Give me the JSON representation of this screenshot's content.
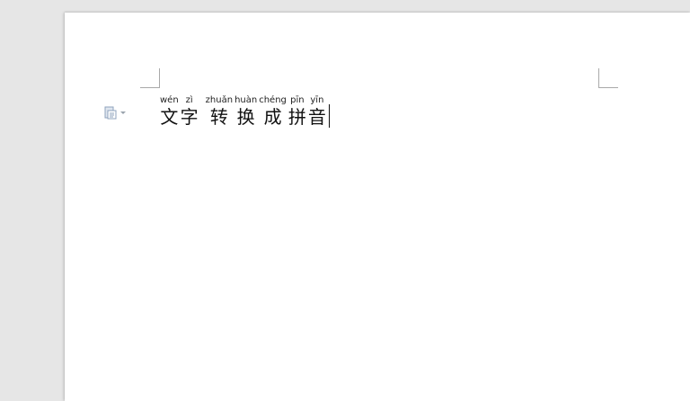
{
  "document": {
    "ruby_text": [
      {
        "hanzi": "文",
        "pinyin": "wén"
      },
      {
        "hanzi": "字",
        "pinyin": "zì"
      },
      {
        "hanzi": "转",
        "pinyin": "zhuǎn"
      },
      {
        "hanzi": "换",
        "pinyin": "huàn"
      },
      {
        "hanzi": "成",
        "pinyin": "chéng"
      },
      {
        "hanzi": "拼",
        "pinyin": "pīn"
      },
      {
        "hanzi": "音",
        "pinyin": "yīn"
      }
    ]
  },
  "icons": {
    "paste_options": "paste-options-icon",
    "dropdown": "chevron-down-icon"
  },
  "colors": {
    "background": "#e6e6e6",
    "page": "#ffffff",
    "margin_marks": "#a9a9a9",
    "text": "#111111",
    "icon": "#8fa3bd"
  }
}
